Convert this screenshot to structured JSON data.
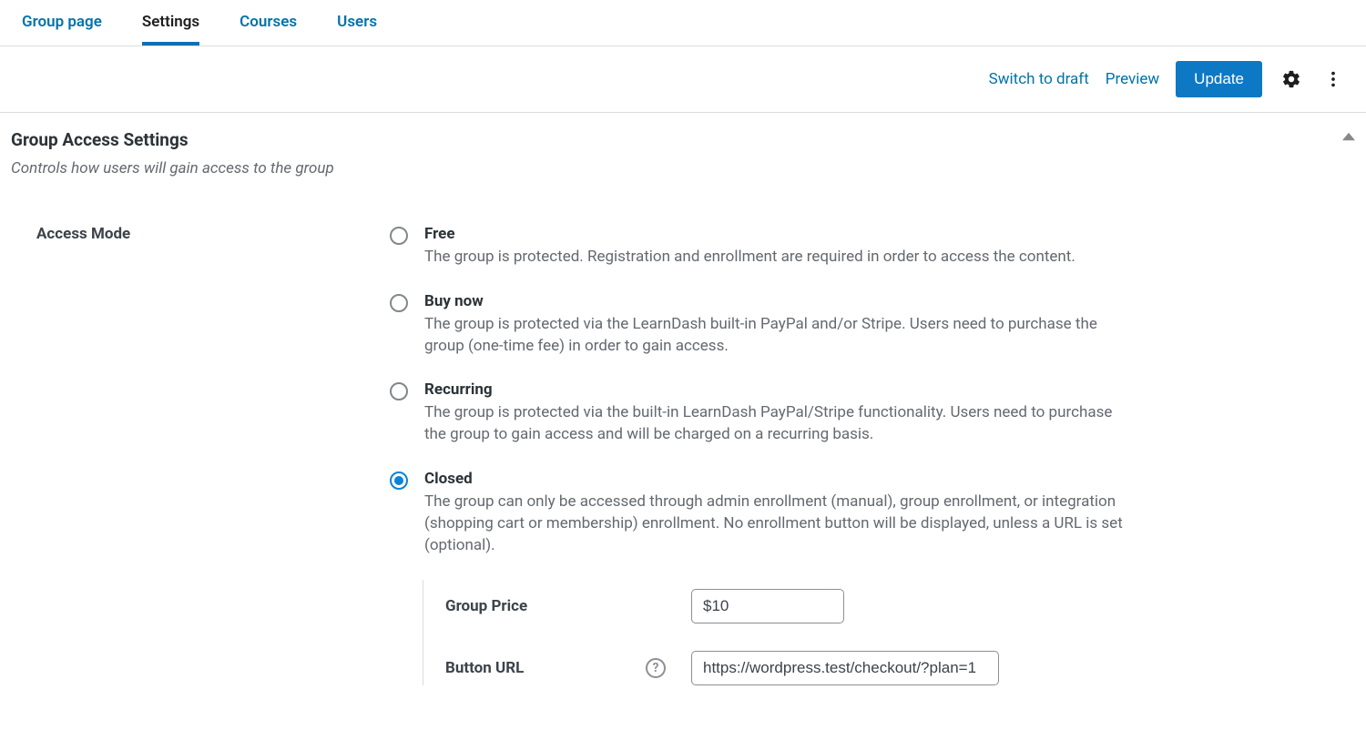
{
  "tabs": [
    {
      "label": "Group page",
      "active": false
    },
    {
      "label": "Settings",
      "active": true
    },
    {
      "label": "Courses",
      "active": false
    },
    {
      "label": "Users",
      "active": false
    }
  ],
  "toolbar": {
    "draft_label": "Switch to draft",
    "preview_label": "Preview",
    "update_label": "Update"
  },
  "panel": {
    "title": "Group Access Settings",
    "desc": "Controls how users will gain access to the group"
  },
  "access_mode": {
    "label": "Access Mode",
    "selected": "closed",
    "options": [
      {
        "key": "free",
        "title": "Free",
        "desc": "The group is protected. Registration and enrollment are required in order to access the content."
      },
      {
        "key": "buynow",
        "title": "Buy now",
        "desc": "The group is protected via the LearnDash built-in PayPal and/or Stripe. Users need to purchase the group (one-time fee) in order to gain access."
      },
      {
        "key": "recurring",
        "title": "Recurring",
        "desc": "The group is protected via the built-in LearnDash PayPal/Stripe functionality. Users need to purchase the group to gain access and will be charged on a recurring basis."
      },
      {
        "key": "closed",
        "title": "Closed",
        "desc": "The group can only be accessed through admin enrollment (manual), group enrollment, or integration (shopping cart or membership) enrollment. No enrollment button will be displayed, unless a URL is set (optional)."
      }
    ],
    "closed_fields": {
      "price_label": "Group Price",
      "price_value": "$10",
      "url_label": "Button URL",
      "url_value": "https://wordpress.test/checkout/?plan=1"
    }
  }
}
